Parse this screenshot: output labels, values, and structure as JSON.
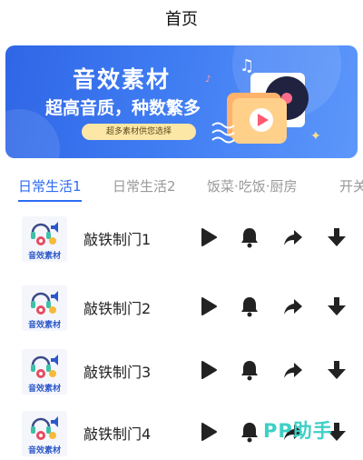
{
  "header": {
    "title": "首页"
  },
  "banner": {
    "title": "音效素材",
    "subtitle": "超高音质，种数繁多",
    "pill": "超多素材供您选择"
  },
  "tabs": [
    {
      "label": "日常生活1",
      "active": true
    },
    {
      "label": "日常生活2",
      "active": false
    },
    {
      "label": "饭菜·吃饭·厨房",
      "active": false
    },
    {
      "label": "开关",
      "active": false
    }
  ],
  "thumb_label": "音效素材",
  "sounds": [
    {
      "name": "敲铁制门1"
    },
    {
      "name": "敲铁制门2"
    },
    {
      "name": "敲铁制门3"
    },
    {
      "name": "敲铁制门4"
    }
  ],
  "icons": {
    "play": "play-icon",
    "ring": "bell-icon",
    "share": "share-icon",
    "download": "download-icon"
  },
  "colors": {
    "accent": "#2d6cf2",
    "watermark": "#3ed0c5"
  },
  "watermark": "PP助手"
}
